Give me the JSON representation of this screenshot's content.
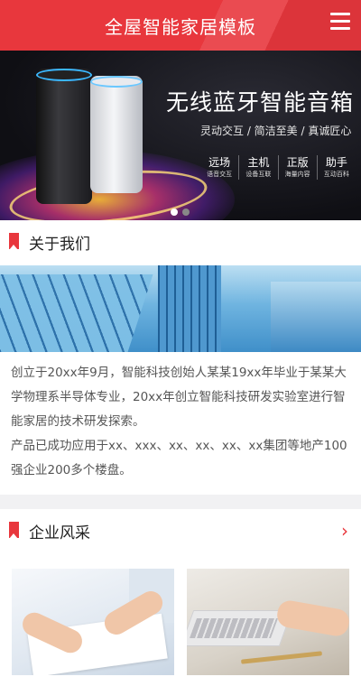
{
  "header": {
    "title": "全屋智能家居模板",
    "menu_icon": "menu-icon"
  },
  "banner": {
    "headline": "无线蓝牙智能音箱",
    "subtitle": "灵动交互 / 简洁至美 / 真诚匠心",
    "features": [
      {
        "title": "远场",
        "subtitle": "语音交互"
      },
      {
        "title": "主机",
        "subtitle": "设备互联"
      },
      {
        "title": "正版",
        "subtitle": "海量内容"
      },
      {
        "title": "助手",
        "subtitle": "互动百科"
      }
    ],
    "slide_count": 2,
    "active_slide": 1
  },
  "about": {
    "title": "关于我们",
    "paragraphs": [
      "创立于20xx年9月，智能科技创始人某某19xx年毕业于某某大学物理系半导体专业，20xx年创立智能科技研发实验室进行智能家居的技术研发探索。",
      "产品已成功应用于xx、xxx、xx、xx、xx、xx集团等地产100强企业200多个楼盘。"
    ]
  },
  "style": {
    "title": "企业风采",
    "more_icon": "chevron-right-icon"
  },
  "colors": {
    "accent": "#e8373d",
    "banner_bg": "#0f0f14",
    "text": "#555555"
  }
}
